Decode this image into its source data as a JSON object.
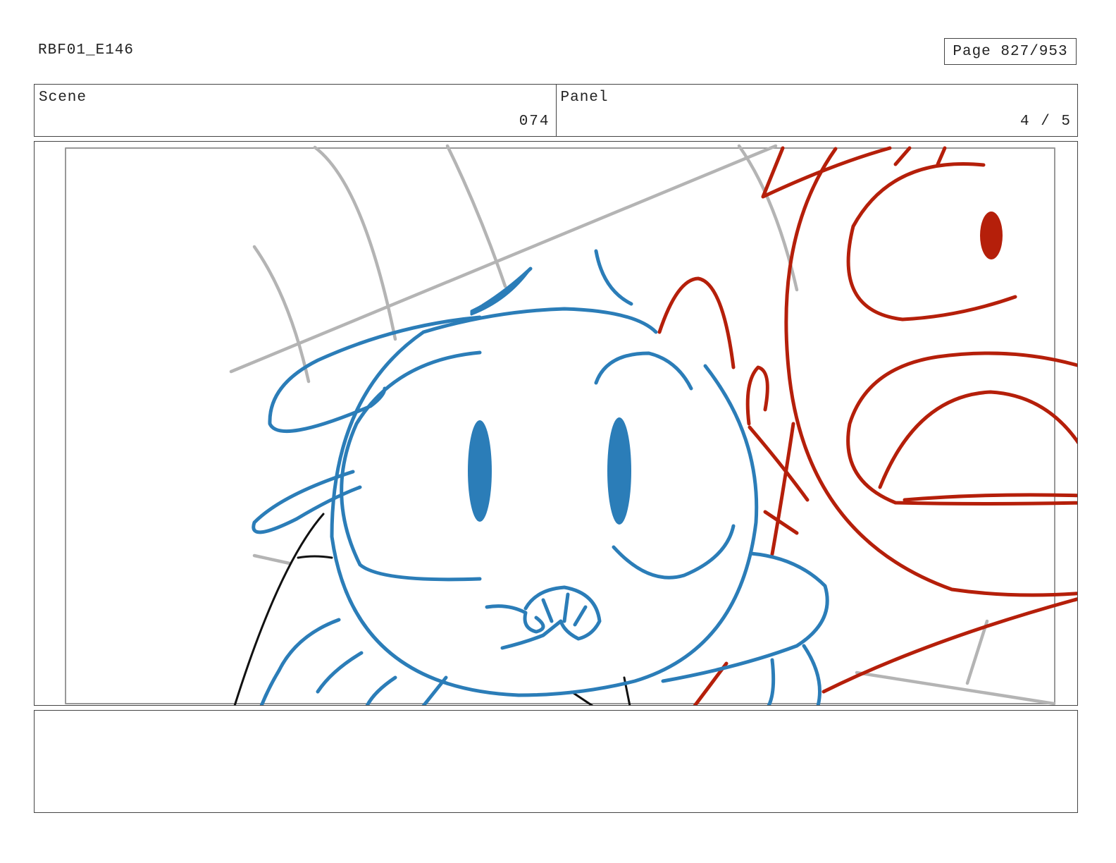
{
  "header": {
    "doc_id": "RBF01_E146",
    "page": "Page 827/953"
  },
  "info": {
    "scene_label": "Scene",
    "scene_value": "074",
    "panel_label": "Panel",
    "panel_value": "4 / 5"
  },
  "artwork": {
    "colors": {
      "blue": "#2b7db8",
      "red": "#b51f0a",
      "gray": "#b4b4b4",
      "black": "#111111"
    }
  },
  "notes": {
    "text": ""
  }
}
